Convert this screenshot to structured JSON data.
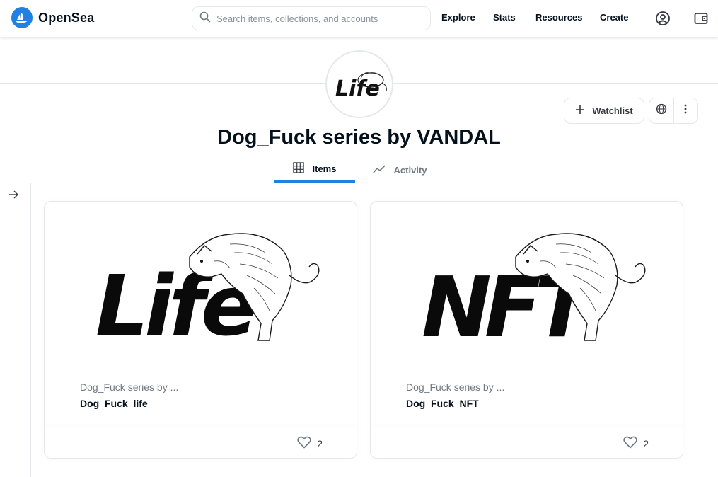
{
  "nav": {
    "logo_text": "OpenSea",
    "search_placeholder": "Search items, collections, and accounts",
    "links": [
      "Explore",
      "Stats",
      "Resources",
      "Create"
    ]
  },
  "collection": {
    "avatar_text": "Life",
    "title": "Dog_Fuck series by VANDAL",
    "watchlist_label": "Watchlist"
  },
  "tabs": [
    {
      "label": "Items",
      "active": true
    },
    {
      "label": "Activity",
      "active": false
    }
  ],
  "items": [
    {
      "collection": "Dog_Fuck series by ...",
      "name": "Dog_Fuck_life",
      "art_text": "Life",
      "likes": "2"
    },
    {
      "collection": "Dog_Fuck series by ...",
      "name": "Dog_Fuck_NFT",
      "art_text": "NFT",
      "likes": "2"
    }
  ],
  "colors": {
    "accent": "#2081e2",
    "text": "#04111d",
    "muted": "#707a83",
    "border": "#e5e8eb"
  }
}
